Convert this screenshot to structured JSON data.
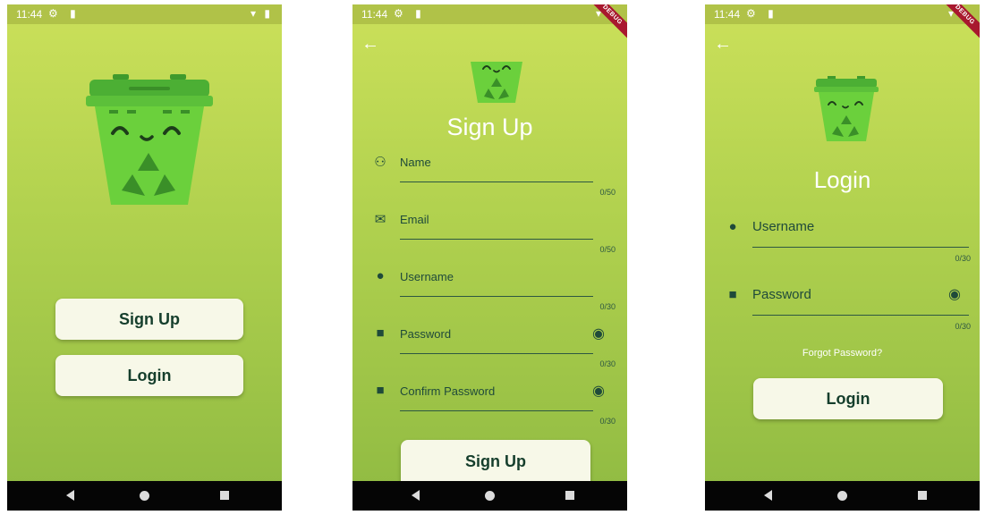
{
  "status": {
    "time": "11:44",
    "debug": "DEBUG"
  },
  "welcome": {
    "signup_label": "Sign Up",
    "login_label": "Login"
  },
  "signup": {
    "title": "Sign Up",
    "fields": [
      {
        "label": "Name",
        "counter": "0/50",
        "icon": "person-outline-icon"
      },
      {
        "label": "Email",
        "counter": "0/50",
        "icon": "mail-icon"
      },
      {
        "label": "Username",
        "counter": "0/30",
        "icon": "person-icon"
      },
      {
        "label": "Password",
        "counter": "0/30",
        "icon": "lock-icon"
      },
      {
        "label": "Confirm Password",
        "counter": "0/30",
        "icon": "lock-icon"
      }
    ],
    "button_label": "Sign Up"
  },
  "login": {
    "title": "Login",
    "fields": [
      {
        "label": "Username",
        "counter": "0/30",
        "icon": "person-icon"
      },
      {
        "label": "Password",
        "counter": "0/30",
        "icon": "lock-icon"
      }
    ],
    "forgot_label": "Forgot Password?",
    "button_label": "Login"
  },
  "colors": {
    "gradient_top": "#cbe05a",
    "gradient_bottom": "#8fba42",
    "button_bg": "#f7f8e8",
    "button_text": "#153e2c",
    "field_accent": "#1f4a3a",
    "bin_green": "#6bd03c"
  }
}
